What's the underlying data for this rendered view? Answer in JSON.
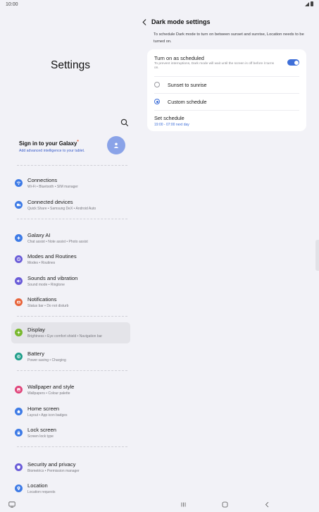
{
  "status_bar": {
    "time": "10:00"
  },
  "left": {
    "title": "Settings",
    "account": {
      "title": "Sign in to your Galaxy",
      "badge": "•",
      "subtitle": "Add advanced intelligence to your tablet."
    },
    "items": [
      {
        "title": "Connections",
        "subtitle": "Wi-Fi • Bluetooth • SIM manager",
        "icon": "wifi-icon",
        "color": "#3e7be6"
      },
      {
        "title": "Connected devices",
        "subtitle": "Quick Share • Samsung DeX • Android Auto",
        "icon": "devices-icon",
        "color": "#3e7be6"
      },
      {
        "title": "Galaxy AI",
        "subtitle": "Chat assist • Note assist • Photo assist",
        "icon": "sparkle-icon",
        "color": "#3e7be6"
      },
      {
        "title": "Modes and Routines",
        "subtitle": "Modes • Routines",
        "icon": "routine-icon",
        "color": "#6a5cd8"
      },
      {
        "title": "Sounds and vibration",
        "subtitle": "Sound mode • Ringtone",
        "icon": "speaker-icon",
        "color": "#6a5cd8"
      },
      {
        "title": "Notifications",
        "subtitle": "Status bar • Do not disturb",
        "icon": "bell-icon",
        "color": "#e8643a"
      },
      {
        "title": "Display",
        "subtitle": "Brightness • Eye comfort shield • Navigation bar",
        "icon": "sun-icon",
        "color": "#78b82e"
      },
      {
        "title": "Battery",
        "subtitle": "Power saving • Charging",
        "icon": "battery-icon",
        "color": "#1f9e8a"
      },
      {
        "title": "Wallpaper and style",
        "subtitle": "Wallpapers • Colour palette",
        "icon": "wallpaper-icon",
        "color": "#e0457b"
      },
      {
        "title": "Home screen",
        "subtitle": "Layout • App icon badges",
        "icon": "home-icon",
        "color": "#3e7be6"
      },
      {
        "title": "Lock screen",
        "subtitle": "Screen lock type",
        "icon": "lock-icon",
        "color": "#3e7be6"
      },
      {
        "title": "Security and privacy",
        "subtitle": "Biometrics • Permission manager",
        "icon": "shield-icon",
        "color": "#6a5cd8"
      },
      {
        "title": "Location",
        "subtitle": "Location requests",
        "icon": "location-pin-icon",
        "color": "#3e7be6"
      }
    ],
    "selected": "Display"
  },
  "right": {
    "title": "Dark mode settings",
    "info": "To schedule Dark mode to turn on between sunset and sunrise, Location needs to be turned on.",
    "scheduled": {
      "title": "Turn on as scheduled",
      "subtitle": "To prevent interruptions, Dark mode will wait until the screen is off before it turns on.",
      "enabled": true
    },
    "options": [
      {
        "label": "Sunset to sunrise",
        "checked": false
      },
      {
        "label": "Custom schedule",
        "checked": true
      }
    ],
    "set_schedule": {
      "title": "Set schedule",
      "value": "19:00 - 07:00 next day"
    }
  },
  "colors": {
    "accent": "#3e6fd8",
    "link": "#3a5dc9"
  }
}
